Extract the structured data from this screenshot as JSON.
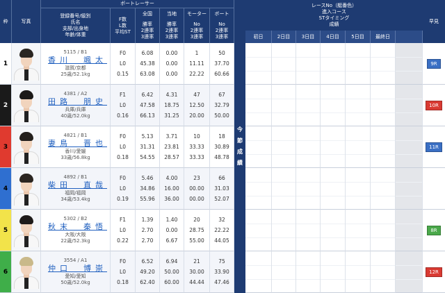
{
  "headers": {
    "waku": "枠",
    "photo": "写真",
    "boat_racer": "ボートレーサー",
    "racer_lines": [
      "登録番号/級別",
      "氏名",
      "支部/出身地",
      "年齢/体重"
    ],
    "f_col": [
      "F数",
      "L数",
      "平均ST"
    ],
    "zenkoku": "全国",
    "tochi": "当地",
    "motor": "モーター",
    "boat": "ボート",
    "rate_lines": [
      "勝率",
      "2連率",
      "3連率"
    ],
    "no_lines": [
      "No",
      "2連率",
      "3連率"
    ],
    "konsetsu": [
      "今",
      "節",
      "成",
      "績"
    ],
    "race_lines": [
      "レースNo（艇番色）",
      "進入コース",
      "STタイミング",
      "成績"
    ],
    "days": [
      "初日",
      "2日目",
      "3日目",
      "4日目",
      "5日目",
      "最終日"
    ],
    "soken": "早見"
  },
  "racers": [
    {
      "waku": "1",
      "color": "#ffffff",
      "reg": "5115 / B1",
      "name": "香川　颯太",
      "branch": "滋賀/京都",
      "age": "25歳/52.1kg",
      "f": [
        "F0",
        "L0",
        "0.15"
      ],
      "zen": [
        "6.08",
        "45.38",
        "63.08"
      ],
      "toch": [
        "0.00",
        "0.00",
        "0.00"
      ],
      "motor": [
        "1",
        "11.11",
        "22.22"
      ],
      "boat": [
        "50",
        "37.70",
        "60.66"
      ],
      "soken": "9R",
      "soken_color": "#3a6fc4",
      "hair": "#2a2622"
    },
    {
      "waku": "2",
      "color": "#1a1a1a",
      "reg": "4381 / A2",
      "name": "田路　朋史",
      "branch": "兵庫/兵庫",
      "age": "40歳/52.0kg",
      "f": [
        "F1",
        "L0",
        "0.16"
      ],
      "zen": [
        "6.42",
        "47.58",
        "66.13"
      ],
      "toch": [
        "4.31",
        "18.75",
        "31.25"
      ],
      "motor": [
        "47",
        "12.50",
        "20.00"
      ],
      "boat": [
        "67",
        "32.79",
        "50.00"
      ],
      "soken": "10R",
      "soken_color": "#d93a32",
      "hair": "#1c1a18"
    },
    {
      "waku": "3",
      "color": "#e03a2f",
      "reg": "4821 / B1",
      "name": "妻鳥　晋也",
      "branch": "香川/愛媛",
      "age": "33歳/56.8kg",
      "f": [
        "F0",
        "L0",
        "0.18"
      ],
      "zen": [
        "5.13",
        "31.31",
        "54.55"
      ],
      "toch": [
        "3.71",
        "23.81",
        "28.57"
      ],
      "motor": [
        "10",
        "33.33",
        "33.33"
      ],
      "boat": [
        "18",
        "30.89",
        "48.78"
      ],
      "soken": "11R",
      "soken_color": "#3a6fc4",
      "hair": "#231f1c"
    },
    {
      "waku": "4",
      "color": "#2f6fd0",
      "reg": "4892 / B1",
      "name": "柴田　直哉",
      "branch": "福岡/福岡",
      "age": "34歳/53.4kg",
      "f": [
        "F0",
        "L0",
        "0.19"
      ],
      "zen": [
        "5.46",
        "34.86",
        "55.96"
      ],
      "toch": [
        "4.00",
        "16.00",
        "36.00"
      ],
      "motor": [
        "23",
        "00.00",
        "00.00"
      ],
      "boat": [
        "66",
        "31.03",
        "52.07"
      ],
      "soken": "",
      "soken_color": "#3a6fc4",
      "hair": "#2b2520"
    },
    {
      "waku": "5",
      "color": "#f2e34a",
      "reg": "5302 / B2",
      "name": "秋末　秦悟",
      "branch": "大阪/大阪",
      "age": "22歳/52.3kg",
      "f": [
        "F1",
        "L0",
        "0.22"
      ],
      "zen": [
        "1.39",
        "2.70",
        "2.70"
      ],
      "toch": [
        "1.40",
        "0.00",
        "6.67"
      ],
      "motor": [
        "20",
        "28.75",
        "55.00"
      ],
      "boat": [
        "32",
        "22.22",
        "44.05"
      ],
      "soken": "8R",
      "soken_color": "#4aa84a",
      "hair": "#1e1b19"
    },
    {
      "waku": "6",
      "color": "#3fae49",
      "reg": "3554 / A1",
      "name": "仲口　博崇",
      "branch": "愛知/愛知",
      "age": "50歳/52.0kg",
      "f": [
        "F0",
        "L0",
        "0.18"
      ],
      "zen": [
        "6.52",
        "49.20",
        "62.40"
      ],
      "toch": [
        "6.94",
        "50.00",
        "60.00"
      ],
      "motor": [
        "21",
        "30.00",
        "44.44"
      ],
      "boat": [
        "75",
        "33.90",
        "47.46"
      ],
      "soken": "12R",
      "soken_color": "#d93a32",
      "hair": "#c9b98a"
    }
  ]
}
